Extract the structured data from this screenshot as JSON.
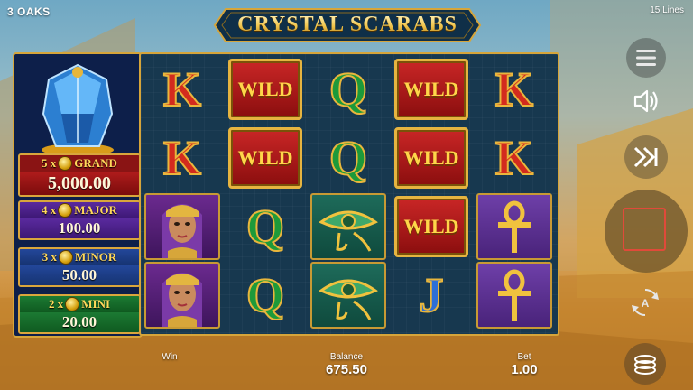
{
  "header": {
    "brand": "3 OAKS",
    "lines": "15 Lines"
  },
  "title": "CRYSTAL SCARABS",
  "jackpots": [
    {
      "multiplier": "5 x",
      "name": "GRAND",
      "amount": "5,000.00"
    },
    {
      "multiplier": "4 x",
      "name": "MAJOR",
      "amount": "100.00"
    },
    {
      "multiplier": "3 x",
      "name": "MINOR",
      "amount": "50.00"
    },
    {
      "multiplier": "2 x",
      "name": "MINI",
      "amount": "20.00"
    }
  ],
  "reels": {
    "wild_label": "WILD",
    "grid": [
      [
        "K",
        "WILD",
        "Q",
        "WILD",
        "K"
      ],
      [
        "K",
        "WILD",
        "Q",
        "WILD",
        "K"
      ],
      [
        "portrait",
        "Q",
        "eye",
        "WILD",
        "ankh"
      ],
      [
        "portrait",
        "Q",
        "eye",
        "J",
        "ankh"
      ]
    ]
  },
  "footer": {
    "win_label": "Win",
    "win_value": "",
    "balance_label": "Balance",
    "balance_value": "675.50",
    "bet_label": "Bet",
    "bet_value": "1.00"
  },
  "controls": [
    "menu-icon",
    "sound-icon",
    "turbo-icon",
    "spin-button",
    "autoplay-icon",
    "bet-coins-icon"
  ],
  "colors": {
    "gold": "#d6a53a",
    "grand": "#8a1414",
    "major": "#5a2a9e",
    "minor": "#23479a",
    "mini": "#1c7a33",
    "spin_accent": "#e04a3a"
  }
}
